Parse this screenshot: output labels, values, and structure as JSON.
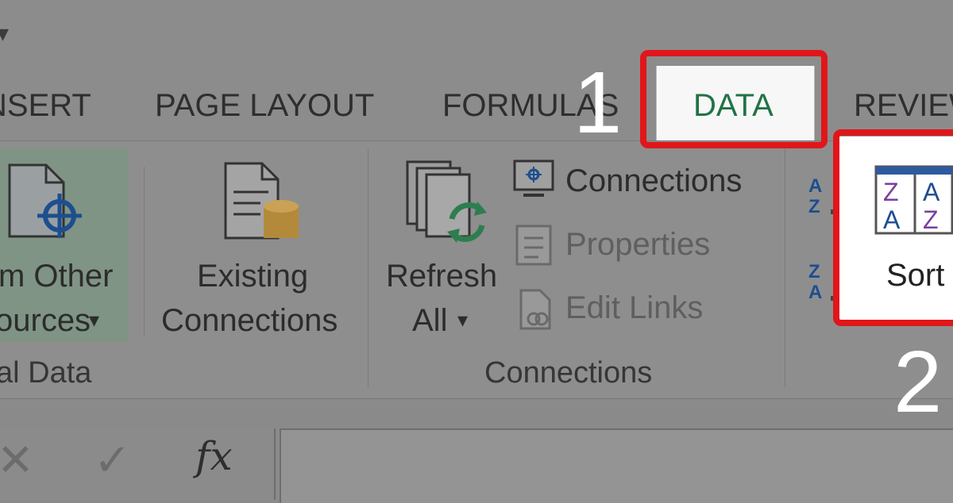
{
  "tabs": {
    "insert": "NSERT",
    "page_layout": "PAGE LAYOUT",
    "formulas": "FORMULAS",
    "data": "DATA",
    "review": "REVIEW"
  },
  "get_external_data": {
    "from_other_line1": "m Other",
    "from_other_line2": "ources",
    "existing_line1": "Existing",
    "existing_line2": "Connections",
    "group_label": "al Data"
  },
  "connections_group": {
    "refresh_line1": "Refresh",
    "refresh_line2": "All",
    "connections": "Connections",
    "properties": "Properties",
    "edit_links": "Edit Links",
    "group_label": "Connections"
  },
  "sort_filter": {
    "sort_label": "Sort",
    "az_icon_top": "A\nZ",
    "za_icon_bottom": "Z\nA"
  },
  "formula_bar": {
    "fx": "fx",
    "cancel_glyph": "✕",
    "enter_glyph": "✓"
  },
  "annotations": {
    "step1": "1",
    "step2": "2",
    "highlight_color": "#e0161b"
  },
  "colors": {
    "accent": "#217346"
  }
}
